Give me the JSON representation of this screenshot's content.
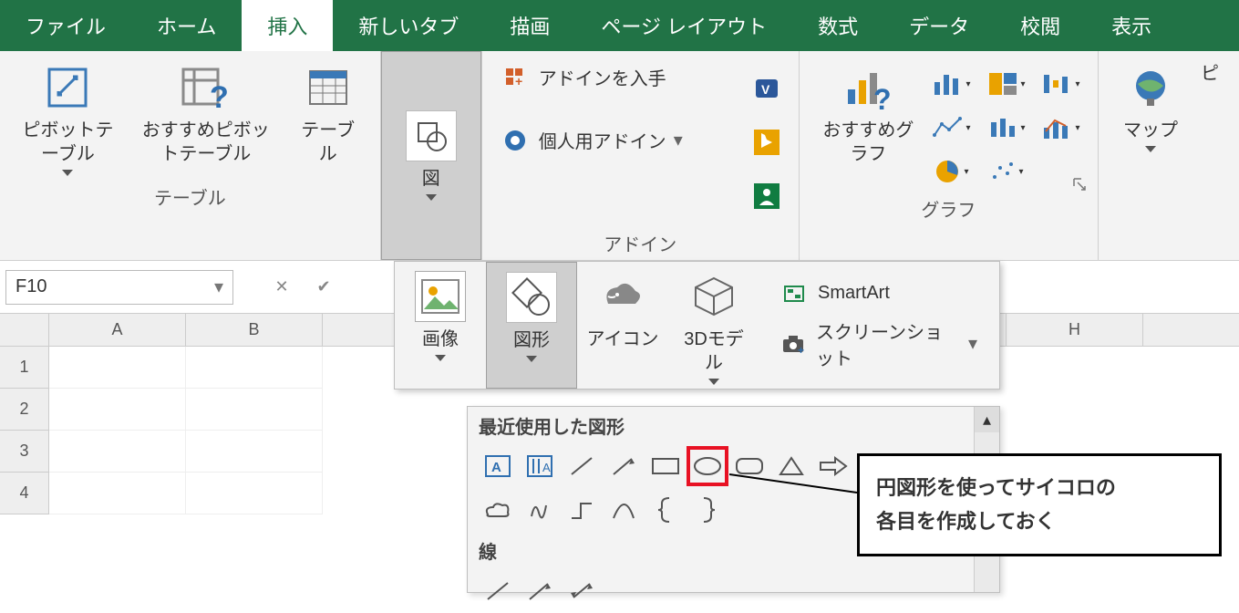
{
  "tabs": {
    "file": "ファイル",
    "home": "ホーム",
    "insert": "挿入",
    "newtab": "新しいタブ",
    "draw": "描画",
    "pagelayout": "ページ レイアウト",
    "formulas": "数式",
    "data": "データ",
    "review": "校閲",
    "view": "表示"
  },
  "ribbon": {
    "tables": {
      "pivot": "ピボットテーブル",
      "recPivot": "おすすめピボットテーブル",
      "table": "テーブル",
      "groupLabel": "テーブル"
    },
    "illustrations": {
      "btn": "図"
    },
    "addins": {
      "get": "アドインを入手",
      "my": "個人用アドイン",
      "groupLabel": "アドイン"
    },
    "charts": {
      "rec": "おすすめグラフ",
      "groupLabel": "グラフ",
      "map": "マップ",
      "pivotchart": "ピ"
    }
  },
  "illDrop": {
    "pictures": "画像",
    "shapes": "図形",
    "icons": "アイコン",
    "models": "3Dモデル",
    "smartart": "SmartArt",
    "screenshot": "スクリーンショット"
  },
  "shapesPop": {
    "recent": "最近使用した図形",
    "lines": "線"
  },
  "callout": {
    "line1": "円図形を使ってサイコロの",
    "line2": "各目を作成しておく"
  },
  "formulaBar": {
    "nameBox": "F10"
  },
  "sheet": {
    "cols": [
      "A",
      "B",
      "",
      "",
      "",
      "",
      "",
      "H"
    ],
    "rows": [
      "1",
      "2",
      "3",
      "4"
    ]
  }
}
